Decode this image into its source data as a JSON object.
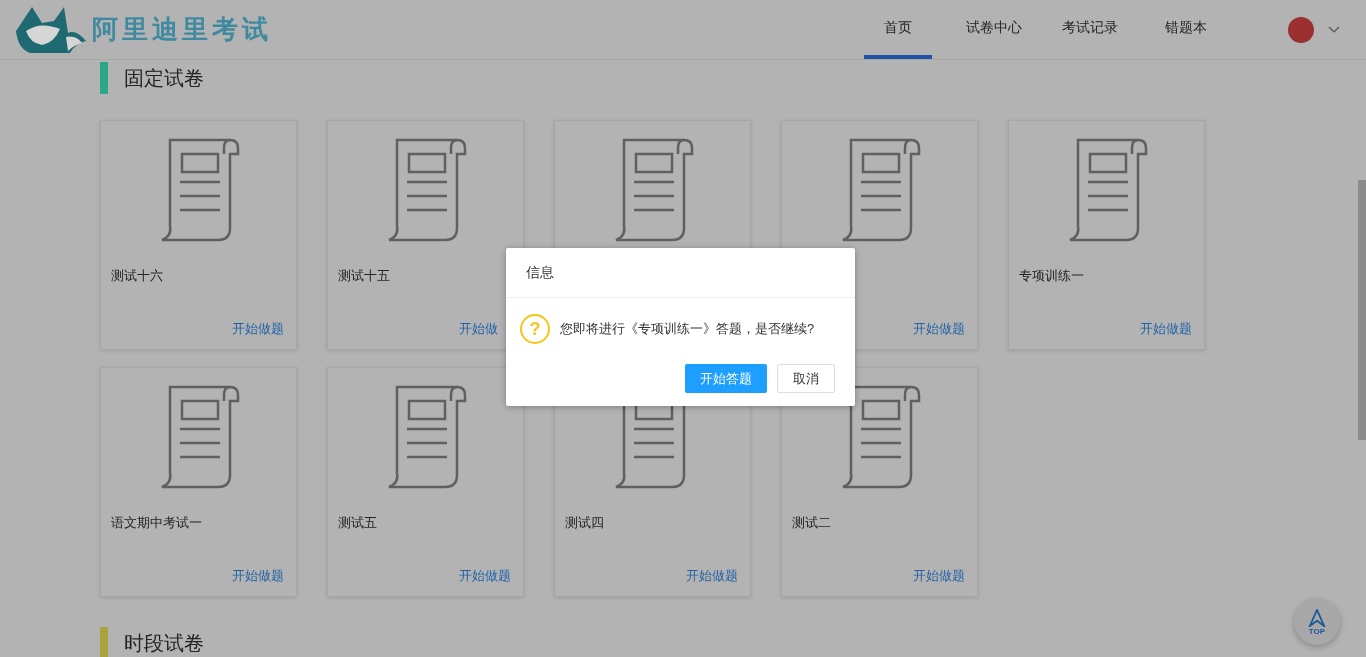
{
  "header": {
    "logo_text": "阿里迪里考试",
    "nav": [
      {
        "label": "首页",
        "selected": true
      },
      {
        "label": "试卷中心",
        "selected": false
      },
      {
        "label": "考试记录",
        "selected": false
      },
      {
        "label": "错题本",
        "selected": false
      }
    ]
  },
  "sections": [
    {
      "title": "固定试卷",
      "color": "#2aa787",
      "cards": [
        {
          "kind": "exam",
          "title": "测试十六",
          "action": "开始做题"
        },
        {
          "kind": "exam",
          "title": "测试十五",
          "action": "开始做"
        },
        {
          "kind": "exam"
        },
        {
          "kind": "exam",
          "action": "开始做题"
        },
        {
          "kind": "exam",
          "title": "专项训练一",
          "action": "开始做题"
        },
        {
          "kind": "exam",
          "title": "语文期中考试一",
          "action": "开始做题"
        },
        {
          "kind": "exam",
          "title": "测试五",
          "action": "开始做题"
        },
        {
          "kind": "exam",
          "title": "测试四",
          "action": "开始做题"
        },
        {
          "kind": "exam",
          "title": "测试二",
          "action": "开始做题"
        }
      ]
    },
    {
      "title": "时段试卷",
      "color": "#aba33a"
    }
  ],
  "back_to_top": {
    "label": "TOP"
  },
  "dialog": {
    "title": "信息",
    "icon_text": "?",
    "message": "您即将进行《专项训练一》答题，是否继续?",
    "buttons": [
      {
        "label": "开始答题",
        "kind": "primary"
      },
      {
        "label": "取消",
        "kind": "secondary"
      }
    ]
  }
}
